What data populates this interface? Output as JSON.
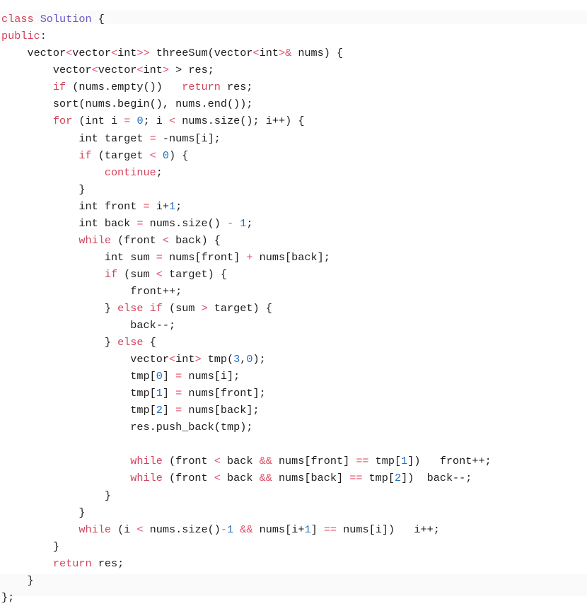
{
  "editor": {
    "language": "cpp",
    "background_color": "#ffffff",
    "edge_band_color": "#fafafa",
    "colors": {
      "plain": "#1d1d1d",
      "keyword": "#d1435b",
      "class_name": "#6559c4",
      "number": "#1f6fc4",
      "operator": "#e0506a"
    }
  },
  "code": {
    "lines": [
      "class Solution {",
      "public:",
      "    vector<vector<int>> threeSum(vector<int>& nums) {",
      "        vector<vector<int> > res;",
      "        if (nums.empty())   return res;",
      "        sort(nums.begin(), nums.end());",
      "        for (int i = 0; i < nums.size(); i++) {",
      "            int target = -nums[i];",
      "            if (target < 0) {",
      "                continue;",
      "            }",
      "            int front = i+1;",
      "            int back = nums.size() - 1;",
      "            while (front < back) {",
      "                int sum = nums[front] + nums[back];",
      "                if (sum < target) {",
      "                    front++;",
      "                } else if (sum > target) {",
      "                    back--;",
      "                } else {",
      "                    vector<int> tmp(3,0);",
      "                    tmp[0] = nums[i];",
      "                    tmp[1] = nums[front];",
      "                    tmp[2] = nums[back];",
      "                    res.push_back(tmp);",
      "",
      "                    while (front < back && nums[front] == tmp[1])   front++;",
      "                    while (front < back && nums[back] == tmp[2])  back--;",
      "                }",
      "            }",
      "            while (i < nums.size()-1 && nums[i+1] == nums[i])   i++;",
      "        }",
      "        return res;",
      "    }",
      "};"
    ],
    "tokens": [
      [
        [
          "class ",
          "kw"
        ],
        [
          "Solution",
          "type"
        ],
        [
          " {",
          "pl"
        ]
      ],
      [
        [
          "public",
          "kw"
        ],
        [
          ":",
          "pl"
        ]
      ],
      [
        [
          "    vector",
          "pl"
        ],
        [
          "<",
          "ang"
        ],
        [
          "vector",
          "pl"
        ],
        [
          "<",
          "ang"
        ],
        [
          "int",
          "pl"
        ],
        [
          ">>",
          "ang"
        ],
        [
          " threeSum(vector",
          "pl"
        ],
        [
          "<",
          "ang"
        ],
        [
          "int",
          "pl"
        ],
        [
          ">",
          "ang"
        ],
        [
          "&",
          "op"
        ],
        [
          " nums) {",
          "pl"
        ]
      ],
      [
        [
          "        vector",
          "pl"
        ],
        [
          "<",
          "ang"
        ],
        [
          "vector",
          "pl"
        ],
        [
          "<",
          "ang"
        ],
        [
          "int",
          "pl"
        ],
        [
          ">",
          "ang"
        ],
        [
          " > res;",
          "pl"
        ]
      ],
      [
        [
          "        ",
          "pl"
        ],
        [
          "if",
          "kw"
        ],
        [
          " (nums.empty())   ",
          "pl"
        ],
        [
          "return",
          "kw"
        ],
        [
          " res;",
          "pl"
        ]
      ],
      [
        [
          "        sort(nums.begin(), nums.end());",
          "pl"
        ]
      ],
      [
        [
          "        ",
          "pl"
        ],
        [
          "for",
          "kw"
        ],
        [
          " (int i ",
          "pl"
        ],
        [
          "=",
          "op"
        ],
        [
          " ",
          "pl"
        ],
        [
          "0",
          "num"
        ],
        [
          "; i ",
          "pl"
        ],
        [
          "<",
          "op"
        ],
        [
          " nums.size(); i++) {",
          "pl"
        ]
      ],
      [
        [
          "            int target ",
          "pl"
        ],
        [
          "=",
          "op"
        ],
        [
          " -nums[i];",
          "pl"
        ]
      ],
      [
        [
          "            ",
          "pl"
        ],
        [
          "if",
          "kw"
        ],
        [
          " (target ",
          "pl"
        ],
        [
          "<",
          "op"
        ],
        [
          " ",
          "pl"
        ],
        [
          "0",
          "num"
        ],
        [
          ") {",
          "pl"
        ]
      ],
      [
        [
          "                ",
          "pl"
        ],
        [
          "continue",
          "kw"
        ],
        [
          ";",
          "pl"
        ]
      ],
      [
        [
          "            }",
          "pl"
        ]
      ],
      [
        [
          "            int front ",
          "pl"
        ],
        [
          "=",
          "op"
        ],
        [
          " i+",
          "pl"
        ],
        [
          "1",
          "num"
        ],
        [
          ";",
          "pl"
        ]
      ],
      [
        [
          "            int back ",
          "pl"
        ],
        [
          "=",
          "op"
        ],
        [
          " nums.size() ",
          "pl"
        ],
        [
          "-",
          "op"
        ],
        [
          " ",
          "pl"
        ],
        [
          "1",
          "num"
        ],
        [
          ";",
          "pl"
        ]
      ],
      [
        [
          "            ",
          "pl"
        ],
        [
          "while",
          "kw"
        ],
        [
          " (front ",
          "pl"
        ],
        [
          "<",
          "op"
        ],
        [
          " back) {",
          "pl"
        ]
      ],
      [
        [
          "                int sum ",
          "pl"
        ],
        [
          "=",
          "op"
        ],
        [
          " nums[front] ",
          "pl"
        ],
        [
          "+",
          "op"
        ],
        [
          " nums[back];",
          "pl"
        ]
      ],
      [
        [
          "                ",
          "pl"
        ],
        [
          "if",
          "kw"
        ],
        [
          " (sum ",
          "pl"
        ],
        [
          "<",
          "op"
        ],
        [
          " target) {",
          "pl"
        ]
      ],
      [
        [
          "                    front++;",
          "pl"
        ]
      ],
      [
        [
          "                } ",
          "pl"
        ],
        [
          "else",
          "kw"
        ],
        [
          " ",
          "pl"
        ],
        [
          "if",
          "kw"
        ],
        [
          " (sum ",
          "pl"
        ],
        [
          ">",
          "op"
        ],
        [
          " target) {",
          "pl"
        ]
      ],
      [
        [
          "                    back--;",
          "pl"
        ]
      ],
      [
        [
          "                } ",
          "pl"
        ],
        [
          "else",
          "kw"
        ],
        [
          " {",
          "pl"
        ]
      ],
      [
        [
          "                    vector",
          "pl"
        ],
        [
          "<",
          "ang"
        ],
        [
          "int",
          "pl"
        ],
        [
          ">",
          "ang"
        ],
        [
          " tmp(",
          "pl"
        ],
        [
          "3",
          "num"
        ],
        [
          ",",
          "pl"
        ],
        [
          "0",
          "num"
        ],
        [
          ");",
          "pl"
        ]
      ],
      [
        [
          "                    tmp[",
          "pl"
        ],
        [
          "0",
          "num"
        ],
        [
          "] ",
          "pl"
        ],
        [
          "=",
          "op"
        ],
        [
          " nums[i];",
          "pl"
        ]
      ],
      [
        [
          "                    tmp[",
          "pl"
        ],
        [
          "1",
          "num"
        ],
        [
          "] ",
          "pl"
        ],
        [
          "=",
          "op"
        ],
        [
          " nums[front];",
          "pl"
        ]
      ],
      [
        [
          "                    tmp[",
          "pl"
        ],
        [
          "2",
          "num"
        ],
        [
          "] ",
          "pl"
        ],
        [
          "=",
          "op"
        ],
        [
          " nums[back];",
          "pl"
        ]
      ],
      [
        [
          "                    res.push_back(tmp);",
          "pl"
        ]
      ],
      [
        [
          "",
          "pl"
        ]
      ],
      [
        [
          "                    ",
          "pl"
        ],
        [
          "while",
          "kw"
        ],
        [
          " (front ",
          "pl"
        ],
        [
          "<",
          "op"
        ],
        [
          " back ",
          "pl"
        ],
        [
          "&&",
          "op"
        ],
        [
          " nums[front] ",
          "pl"
        ],
        [
          "==",
          "op"
        ],
        [
          " tmp[",
          "pl"
        ],
        [
          "1",
          "num"
        ],
        [
          "])   front++;",
          "pl"
        ]
      ],
      [
        [
          "                    ",
          "pl"
        ],
        [
          "while",
          "kw"
        ],
        [
          " (front ",
          "pl"
        ],
        [
          "<",
          "op"
        ],
        [
          " back ",
          "pl"
        ],
        [
          "&&",
          "op"
        ],
        [
          " nums[back] ",
          "pl"
        ],
        [
          "==",
          "op"
        ],
        [
          " tmp[",
          "pl"
        ],
        [
          "2",
          "num"
        ],
        [
          "])  back--;",
          "pl"
        ]
      ],
      [
        [
          "                }",
          "pl"
        ]
      ],
      [
        [
          "            }",
          "pl"
        ]
      ],
      [
        [
          "            ",
          "pl"
        ],
        [
          "while",
          "kw"
        ],
        [
          " (i ",
          "pl"
        ],
        [
          "<",
          "op"
        ],
        [
          " nums.size()",
          "pl"
        ],
        [
          "-",
          "op"
        ],
        [
          "1",
          "num"
        ],
        [
          " ",
          "pl"
        ],
        [
          "&&",
          "op"
        ],
        [
          " nums[i+",
          "pl"
        ],
        [
          "1",
          "num"
        ],
        [
          "] ",
          "pl"
        ],
        [
          "==",
          "op"
        ],
        [
          " nums[i])   i++;",
          "pl"
        ]
      ],
      [
        [
          "        }",
          "pl"
        ]
      ],
      [
        [
          "        ",
          "pl"
        ],
        [
          "return",
          "kw"
        ],
        [
          " res;",
          "pl"
        ]
      ],
      [
        [
          "    }",
          "pl"
        ]
      ],
      [
        [
          "};",
          "pl"
        ]
      ]
    ]
  }
}
